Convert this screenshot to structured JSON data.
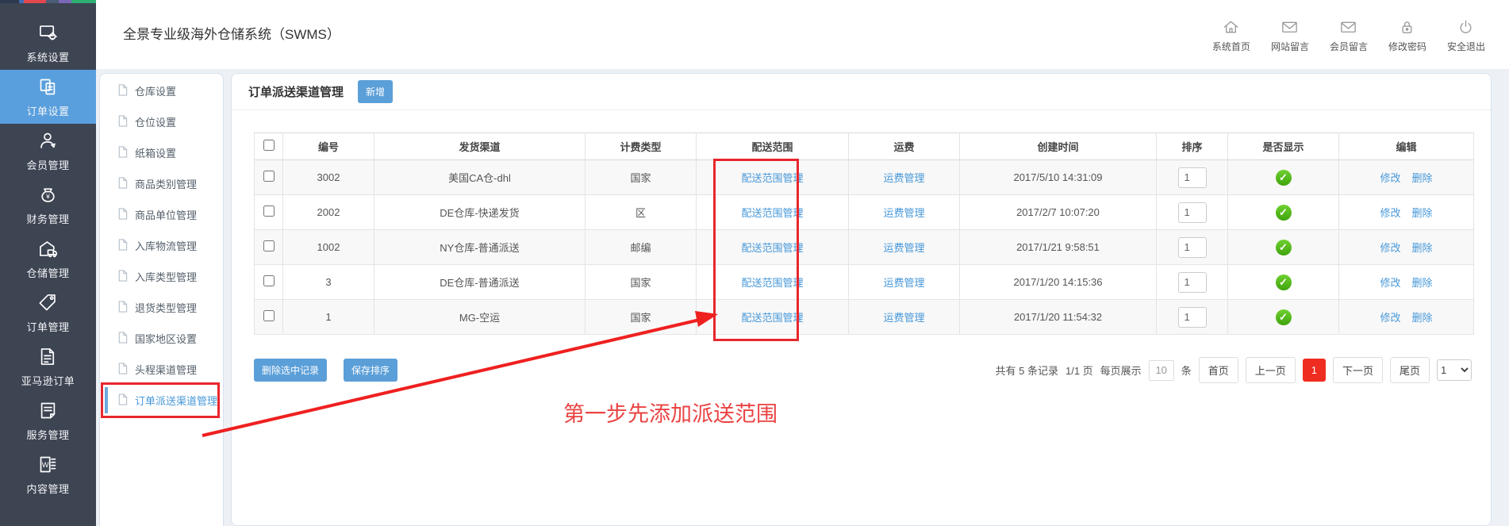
{
  "app": {
    "title": "全景专业级海外仓储系统（SWMS）"
  },
  "header": {
    "quick_links": [
      {
        "label": "系统首页",
        "icon": "home-icon"
      },
      {
        "label": "网站留言",
        "icon": "site-mail-icon"
      },
      {
        "label": "会员留言",
        "icon": "member-mail-icon"
      },
      {
        "label": "修改密码",
        "icon": "lock-icon"
      },
      {
        "label": "安全退出",
        "icon": "power-icon"
      }
    ]
  },
  "sidebar": {
    "items": [
      {
        "label": "系统设置",
        "icon": "system-settings-icon",
        "active": false
      },
      {
        "label": "订单设置",
        "icon": "order-settings-icon",
        "active": true
      },
      {
        "label": "会员管理",
        "icon": "member-management-icon",
        "active": false
      },
      {
        "label": "财务管理",
        "icon": "finance-management-icon",
        "active": false
      },
      {
        "label": "仓储管理",
        "icon": "warehouse-management-icon",
        "active": false
      },
      {
        "label": "订单管理",
        "icon": "order-management-icon",
        "active": false
      },
      {
        "label": "亚马逊订单",
        "icon": "amazon-orders-icon",
        "active": false
      },
      {
        "label": "服务管理",
        "icon": "service-management-icon",
        "active": false
      },
      {
        "label": "内容管理",
        "icon": "content-management-icon",
        "active": false
      }
    ]
  },
  "submenu": {
    "items": [
      {
        "label": "仓库设置",
        "active": false
      },
      {
        "label": "仓位设置",
        "active": false
      },
      {
        "label": "纸箱设置",
        "active": false
      },
      {
        "label": "商品类别管理",
        "active": false
      },
      {
        "label": "商品单位管理",
        "active": false
      },
      {
        "label": "入库物流管理",
        "active": false
      },
      {
        "label": "入库类型管理",
        "active": false
      },
      {
        "label": "退货类型管理",
        "active": false
      },
      {
        "label": "国家地区设置",
        "active": false
      },
      {
        "label": "头程渠道管理",
        "active": false
      },
      {
        "label": "订单派送渠道管理",
        "active": true
      }
    ]
  },
  "main": {
    "panel_title": "订单派送渠道管理",
    "add_button": "新增",
    "table": {
      "headers": [
        "编号",
        "发货渠道",
        "计费类型",
        "配送范围",
        "运费",
        "创建时间",
        "排序",
        "是否显示",
        "编辑"
      ],
      "range_link_label": "配送范围管理",
      "freight_link_label": "运费管理",
      "modify_label": "修改",
      "delete_label": "删除",
      "rows": [
        {
          "code": "3002",
          "channel": "美国CA仓-dhl",
          "fee_type": "国家",
          "created": "2017/5/10 14:31:09",
          "sort": "1",
          "visible": true
        },
        {
          "code": "2002",
          "channel": "DE仓库-快递发货",
          "fee_type": "区",
          "created": "2017/2/7 10:07:20",
          "sort": "1",
          "visible": true
        },
        {
          "code": "1002",
          "channel": "NY仓库-普通派送",
          "fee_type": "邮编",
          "created": "2017/1/21 9:58:51",
          "sort": "1",
          "visible": true
        },
        {
          "code": "3",
          "channel": "DE仓库-普通派送",
          "fee_type": "国家",
          "created": "2017/1/20 14:15:36",
          "sort": "1",
          "visible": true
        },
        {
          "code": "1",
          "channel": "MG-空运",
          "fee_type": "国家",
          "created": "2017/1/20 11:54:32",
          "sort": "1",
          "visible": true
        }
      ]
    },
    "delete_selected_button": "删除选中记录",
    "save_sort_button": "保存排序",
    "pagination": {
      "total_text": "共有 5 条记录",
      "page_text": "1/1 页",
      "per_page_prefix": "每页展示",
      "per_page_value": "10",
      "per_page_suffix": "条",
      "first_label": "首页",
      "prev_label": "上一页",
      "current_page": "1",
      "next_label": "下一页",
      "last_label": "尾页",
      "jump_value": "1"
    }
  },
  "annotation": {
    "step_text": "第一步先添加派送范围"
  },
  "colors": {
    "accent_blue": "#5b9fd8",
    "sidebar_dark": "#3d4452",
    "sidebar_active": "#599fdd",
    "link_blue": "#4798d9",
    "pagination_current_red": "#ee2c1f",
    "success_green": "#47b81c",
    "annotation_red": "#e8262d"
  }
}
